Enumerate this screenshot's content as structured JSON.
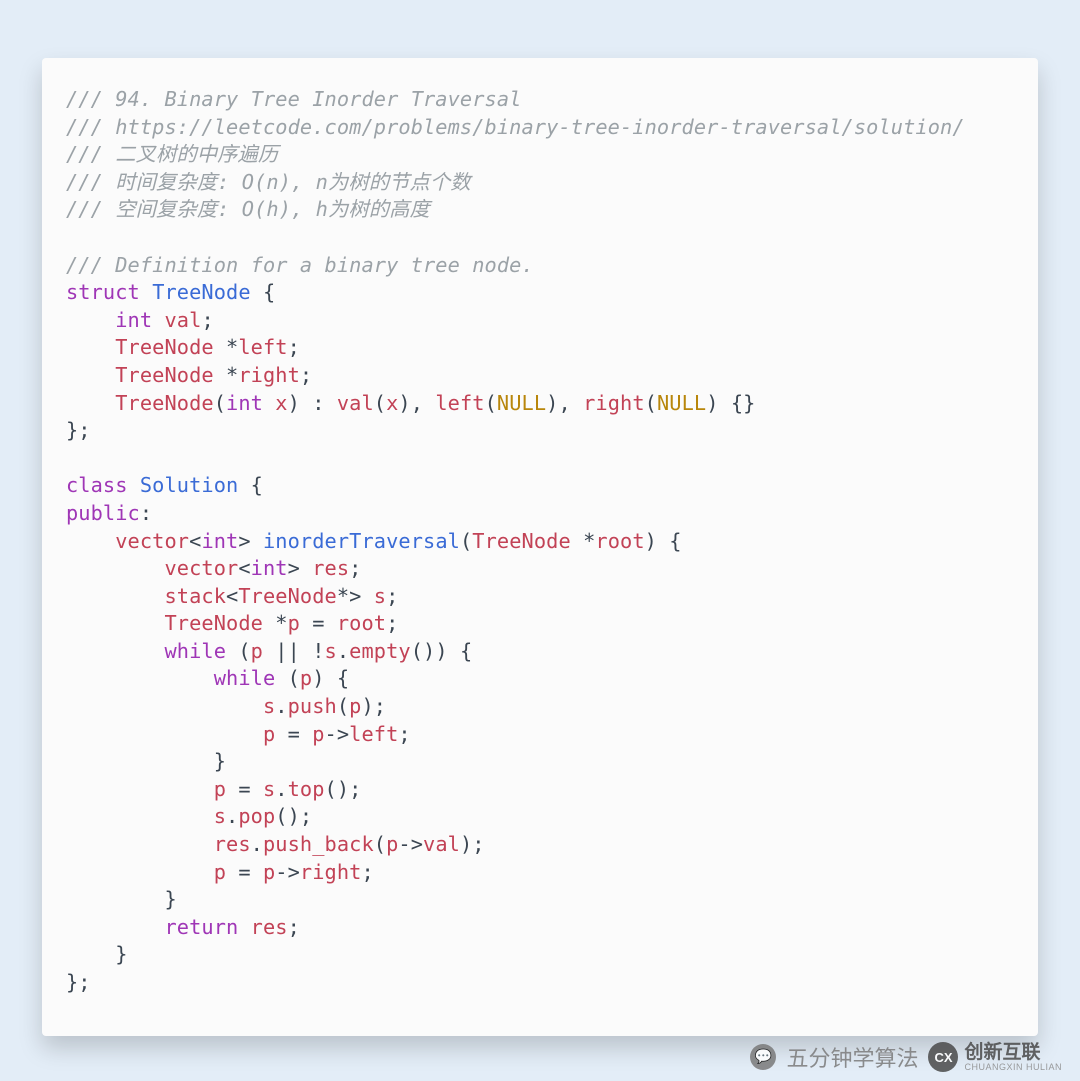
{
  "code": {
    "c1": "/// 94. Binary Tree Inorder Traversal",
    "c2": "/// https://leetcode.com/problems/binary-tree-inorder-traversal/solution/",
    "c3": "/// 二叉树的中序遍历",
    "c4": "/// 时间复杂度: O(n), n为树的节点个数",
    "c5": "/// 空间复杂度: O(h), h为树的高度",
    "c6": "/// Definition for a binary tree node.",
    "kw_struct": "struct",
    "ty_TreeNode": "TreeNode",
    "l_brace": " {",
    "kw_int": "int",
    "id_val": "val",
    "semi": ";",
    "id_TreeNode": "TreeNode",
    "star": " *",
    "id_left": "left",
    "id_right": "right",
    "ctor_TreeNode": "TreeNode",
    "ctor_params_open": "(",
    "ctor_params_close": ")",
    "id_x": "x",
    "colon_sp": " : ",
    "fn_val": "val",
    "fn_left": "left",
    "fn_right": "right",
    "null": "NULL",
    "empty_body": " {}",
    "r_brace_semi": "};",
    "kw_class": "class",
    "ty_Solution": "Solution",
    "kw_public": "public",
    "colon": ":",
    "id_vector": "vector",
    "lt": "<",
    "gt": ">",
    "fn_inorder": "inorderTraversal",
    "id_root": "root",
    "id_res": "res",
    "id_stack": "stack",
    "star2": "*",
    "id_s": "s",
    "id_p": "p",
    "eq": " = ",
    "kw_while": "while",
    "op_or": " || ",
    "bang": "!",
    "dot": ".",
    "fn_empty": "empty",
    "parens": "()",
    "fn_push": "push",
    "arrow": "->",
    "fn_top": "top",
    "fn_pop": "pop",
    "fn_push_back": "push_back",
    "kw_return": "return",
    "r_brace": "}",
    "comma_sp": ", "
  },
  "footer": {
    "text": "五分钟学算法",
    "brand": "创新互联",
    "brand_sub": "CHUANGXIN HULIAN"
  }
}
